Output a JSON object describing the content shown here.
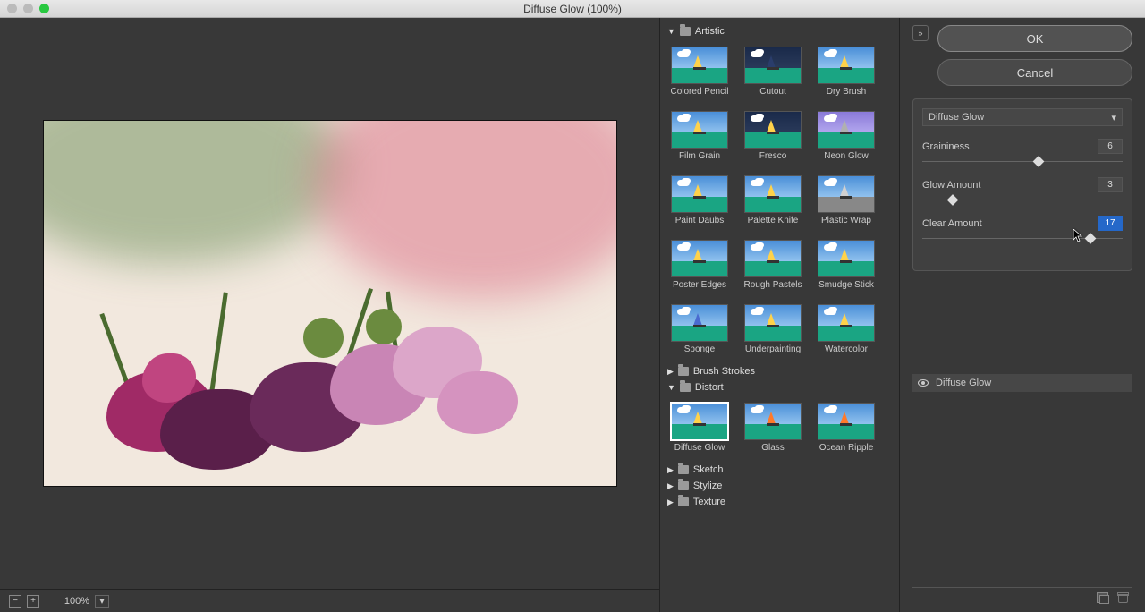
{
  "window": {
    "title": "Diffuse Glow (100%)"
  },
  "preview": {
    "zoom": "100%"
  },
  "gallery": {
    "categories": [
      {
        "name": "Artistic",
        "expanded": true,
        "items": [
          {
            "label": "Colored Pencil",
            "sail": "#ffd24a",
            "style": "hatched"
          },
          {
            "label": "Cutout",
            "sail": "#2a3d6b",
            "style": "flat-dark"
          },
          {
            "label": "Dry Brush",
            "sail": "#ffd24a",
            "style": "soft"
          },
          {
            "label": "Film Grain",
            "sail": "#ffd24a",
            "style": "grain"
          },
          {
            "label": "Fresco",
            "sail": "#ffd24a",
            "style": "dark"
          },
          {
            "label": "Neon Glow",
            "sail": "#b0b0b0",
            "style": "purple"
          },
          {
            "label": "Paint Daubs",
            "sail": "#ffd24a",
            "style": "daub"
          },
          {
            "label": "Palette Knife",
            "sail": "#ffd24a",
            "style": "knife"
          },
          {
            "label": "Plastic Wrap",
            "sail": "#d0d0d0",
            "style": "gray"
          },
          {
            "label": "Poster Edges",
            "sail": "#ffd24a",
            "style": "poster"
          },
          {
            "label": "Rough Pastels",
            "sail": "#ffd24a",
            "style": "pastel"
          },
          {
            "label": "Smudge Stick",
            "sail": "#ffd24a",
            "style": "smudge"
          },
          {
            "label": "Sponge",
            "sail": "#4a6bd0",
            "style": "sponge"
          },
          {
            "label": "Underpainting",
            "sail": "#ffd24a",
            "style": "under"
          },
          {
            "label": "Watercolor",
            "sail": "#ffd24a",
            "style": "water"
          }
        ]
      },
      {
        "name": "Brush Strokes",
        "expanded": false
      },
      {
        "name": "Distort",
        "expanded": true,
        "items": [
          {
            "label": "Diffuse Glow",
            "sail": "#ffd24a",
            "style": "glow",
            "selected": true
          },
          {
            "label": "Glass",
            "sail": "#ff7a2a",
            "style": "glass"
          },
          {
            "label": "Ocean Ripple",
            "sail": "#ff7a2a",
            "style": "ripple"
          }
        ]
      },
      {
        "name": "Sketch",
        "expanded": false
      },
      {
        "name": "Stylize",
        "expanded": false
      },
      {
        "name": "Texture",
        "expanded": false
      }
    ]
  },
  "controls": {
    "ok": "OK",
    "cancel": "Cancel",
    "filter_name": "Diffuse Glow",
    "params": [
      {
        "label": "Graininess",
        "value": "6",
        "pos": 58
      },
      {
        "label": "Glow Amount",
        "value": "3",
        "pos": 15
      },
      {
        "label": "Clear Amount",
        "value": "17",
        "pos": 84,
        "selected": true
      }
    ]
  },
  "layers": {
    "items": [
      {
        "name": "Diffuse Glow",
        "visible": true
      }
    ]
  }
}
